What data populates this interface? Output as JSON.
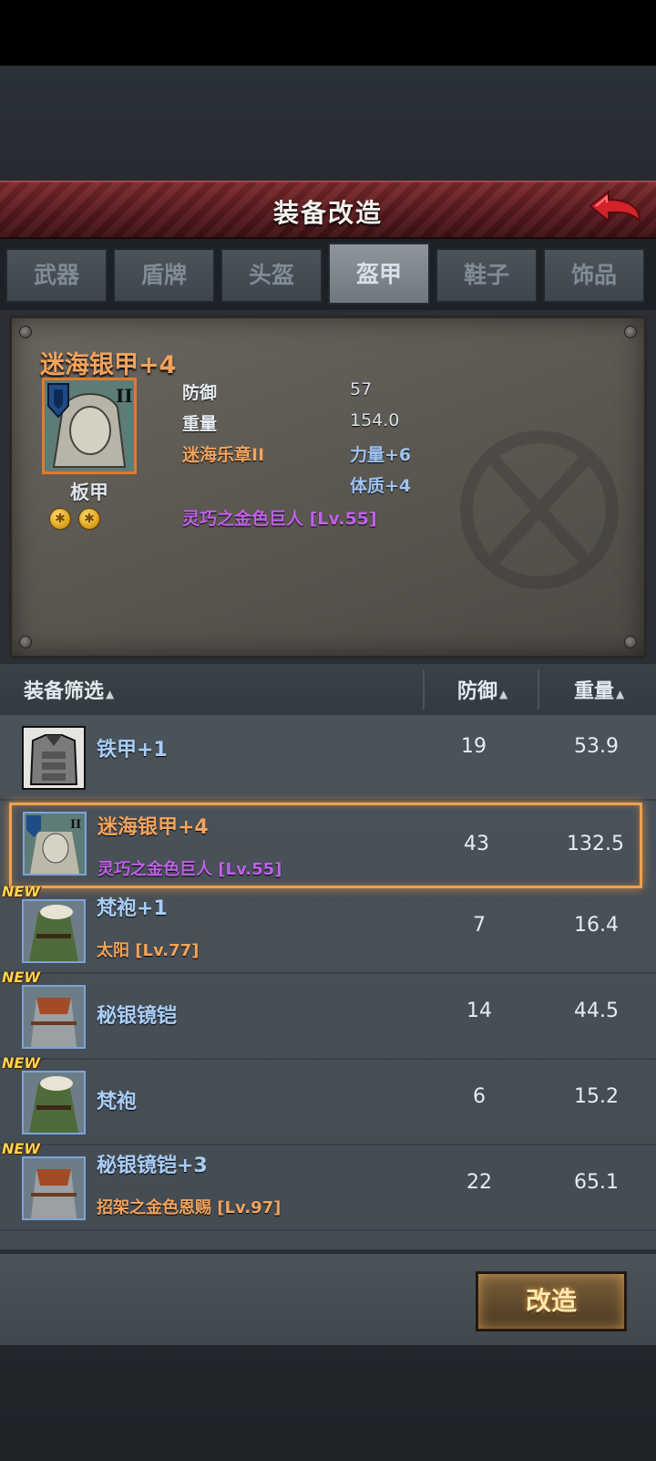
{
  "header": {
    "title": "装备改造"
  },
  "tabs": [
    "武器",
    "盾牌",
    "头盔",
    "盔甲",
    "鞋子",
    "饰品"
  ],
  "active_tab": "盔甲",
  "detail": {
    "name": "迷海银甲+4",
    "type_label": "板甲",
    "tier": "II",
    "stats": {
      "defense_label": "防御",
      "defense_value": "57",
      "weight_label": "重量",
      "weight_value": "154.0",
      "set_label": "迷海乐章II",
      "bonus1": "力量+6",
      "bonus2": "体质+4",
      "blessing": "灵巧之金色巨人 [Lv.55]"
    }
  },
  "list_header": {
    "filter": "装备筛选",
    "defense": "防御",
    "weight": "重量"
  },
  "items": [
    {
      "name": "铁甲+1",
      "sub": "",
      "defense": "19",
      "weight": "53.9",
      "new": false,
      "selected": false
    },
    {
      "name": "迷海银甲+4",
      "sub": "灵巧之金色巨人 [Lv.55]",
      "defense": "43",
      "weight": "132.5",
      "new": false,
      "selected": true
    },
    {
      "name": "梵袍+1",
      "sub": "太阳 [Lv.77]",
      "defense": "7",
      "weight": "16.4",
      "new": true,
      "selected": false
    },
    {
      "name": "秘银镜铠",
      "sub": "",
      "defense": "14",
      "weight": "44.5",
      "new": true,
      "selected": false
    },
    {
      "name": "梵袍",
      "sub": "",
      "defense": "6",
      "weight": "15.2",
      "new": true,
      "selected": false
    },
    {
      "name": "秘银镜铠+3",
      "sub": "招架之金色恩赐 [Lv.97]",
      "defense": "22",
      "weight": "65.1",
      "new": true,
      "selected": false
    }
  ],
  "new_badge": "NEW",
  "action": {
    "modify_label": "改造"
  },
  "colors": {
    "accent_orange": "#f2a35c",
    "title_red": "#5a1b1f",
    "purple": "#c061e8",
    "blue_name": "#a9cdf6"
  }
}
